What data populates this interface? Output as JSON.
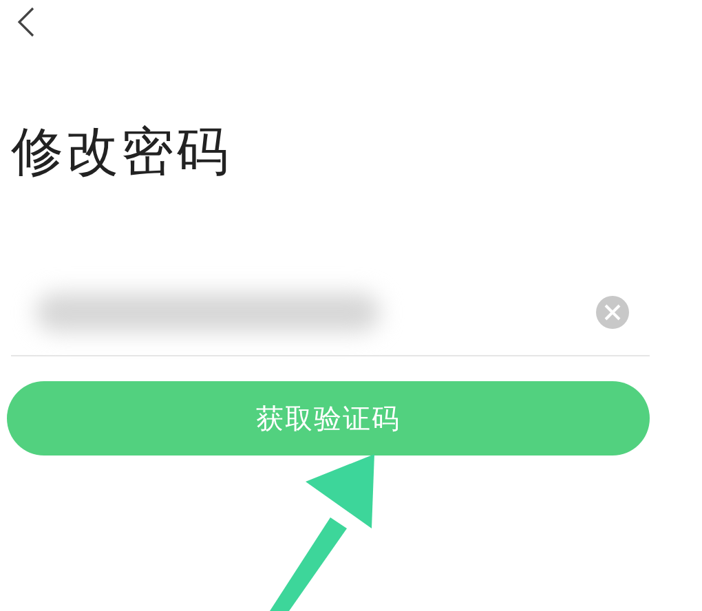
{
  "title": "修改密码",
  "phone_field": {
    "redacted": true
  },
  "button": {
    "label": "获取验证码"
  },
  "annotation": {
    "kind": "arrow"
  }
}
